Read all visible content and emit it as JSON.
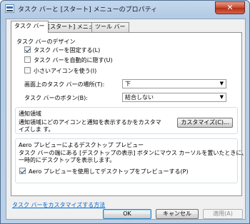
{
  "window": {
    "title": "タスク バーと [スタート] メニューのプロパティ",
    "close_glyph": "✕"
  },
  "tabs": [
    {
      "label": "タスク バー",
      "active": true
    },
    {
      "label": "[スタート] メニュー",
      "active": false
    },
    {
      "label": "ツール バー",
      "active": false
    }
  ],
  "taskbar_design": {
    "title": "タスク バーのデザイン",
    "checks": [
      {
        "label": "タスク バーを固定する(L)",
        "checked": true
      },
      {
        "label": "タスク バーを自動的に隠す(U)",
        "checked": false
      },
      {
        "label": "小さいアイコンを使う(I)",
        "checked": false
      }
    ],
    "location_label": "画面上のタスク バーの場所(T):",
    "location_value": "下",
    "buttons_label": "タスク バーのボタン(B):",
    "buttons_value": "結合しない"
  },
  "notification": {
    "title": "通知領域",
    "description": "通知領域にどのアイコンと通知を表示するかをカスタマイズしま す。",
    "customize_button": "カスタマイズ(C)..."
  },
  "aero": {
    "title": "Aero プレビューによるデスクトップ プレビュー",
    "description_line1": "タスク バーの端にある [デスクトップの表示] ボタンにマウス カーソルを置いたときに、",
    "description_line2": "一時的にデスクトップを表示します。",
    "check_label": "Aero プレビューを使用してデスクトップをプレビューする(P)",
    "checked": true
  },
  "link": "タスク バーをカスタマイズする方法",
  "footer": {
    "ok": "OK",
    "cancel": "キャンセル",
    "apply": "適用(A)"
  },
  "icons": {
    "dropdown": "▼"
  }
}
